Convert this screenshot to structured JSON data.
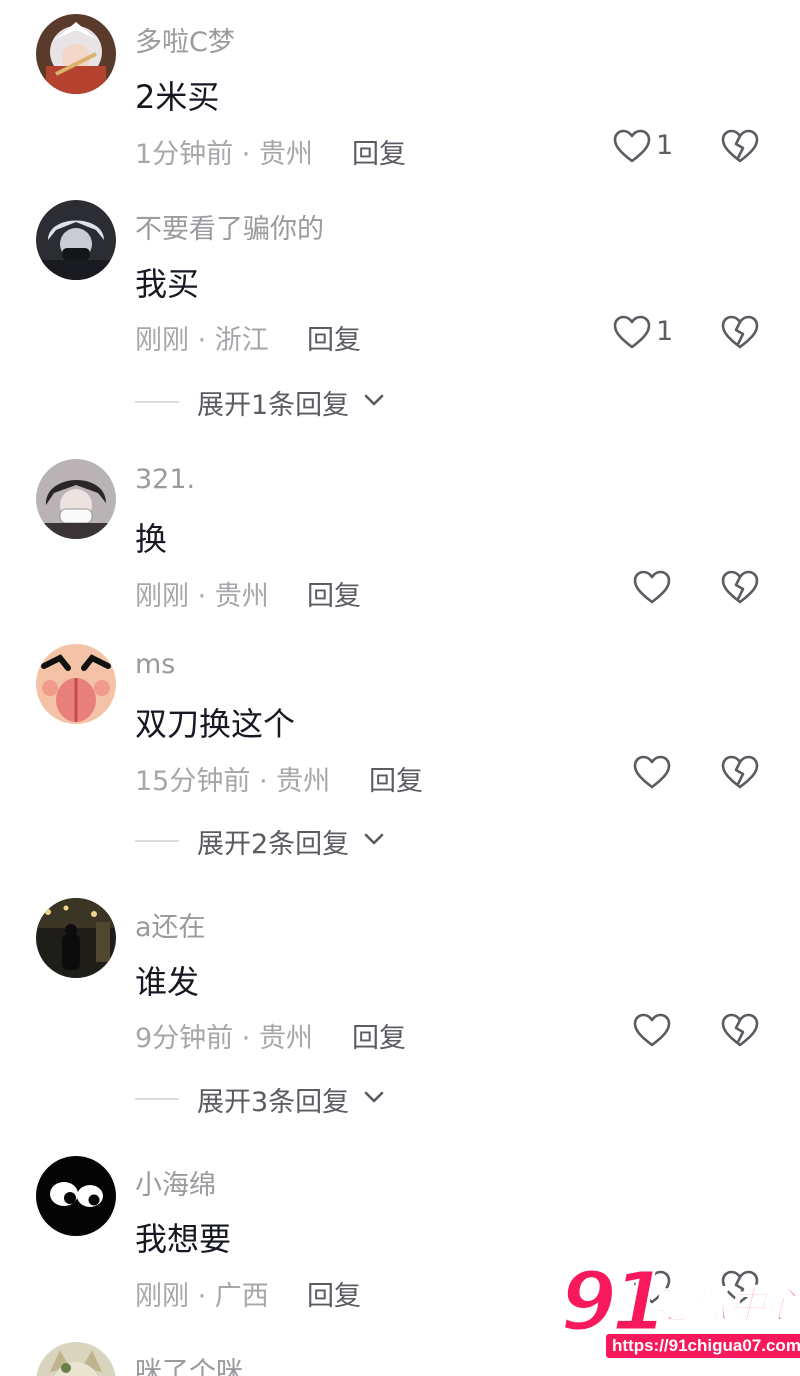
{
  "comments": [
    {
      "username": "多啦C梦",
      "text": "2米买",
      "time": "1分钟前",
      "location": "贵州",
      "reply_label": "回复",
      "likes": "1",
      "expand_label": "",
      "avatar_icon": "anime-white-hair-avatar-icon"
    },
    {
      "username": "不要看了骗你的",
      "text": "我买",
      "time": "刚刚",
      "location": "浙江",
      "reply_label": "回复",
      "likes": "1",
      "expand_label": "展开1条回复",
      "avatar_icon": "anime-masked-boy-avatar-icon"
    },
    {
      "username": "321.",
      "text": "换",
      "time": "刚刚",
      "location": "贵州",
      "reply_label": "回复",
      "likes": "",
      "expand_label": "",
      "avatar_icon": "anime-mask-avatar-icon"
    },
    {
      "username": "ms",
      "text": "双刀换这个",
      "time": "15分钟前",
      "location": "贵州",
      "reply_label": "回复",
      "likes": "",
      "expand_label": "展开2条回复",
      "avatar_icon": "cartoon-face-avatar-icon"
    },
    {
      "username": "a还在",
      "text": "谁发",
      "time": "9分钟前",
      "location": "贵州",
      "reply_label": "回复",
      "likes": "",
      "expand_label": "展开3条回复",
      "avatar_icon": "night-street-avatar-icon"
    },
    {
      "username": "小海绵",
      "text": "我想要",
      "time": "刚刚",
      "location": "广西",
      "reply_label": "回复",
      "likes": "",
      "expand_label": "",
      "avatar_icon": "black-eyes-avatar-icon"
    },
    {
      "username": "咪了个咪",
      "text": "",
      "time": "",
      "location": "",
      "reply_label": "",
      "likes": "",
      "expand_label": "",
      "avatar_icon": "cat-avatar-icon"
    }
  ],
  "separator": " · ",
  "watermark": {
    "brand_number": "91",
    "brand_text": "吃瓜中心",
    "url": "https://91chigua07.com"
  },
  "colors": {
    "text": "#161823",
    "muted": "#a7a7ab",
    "accent": "#f7195b"
  }
}
